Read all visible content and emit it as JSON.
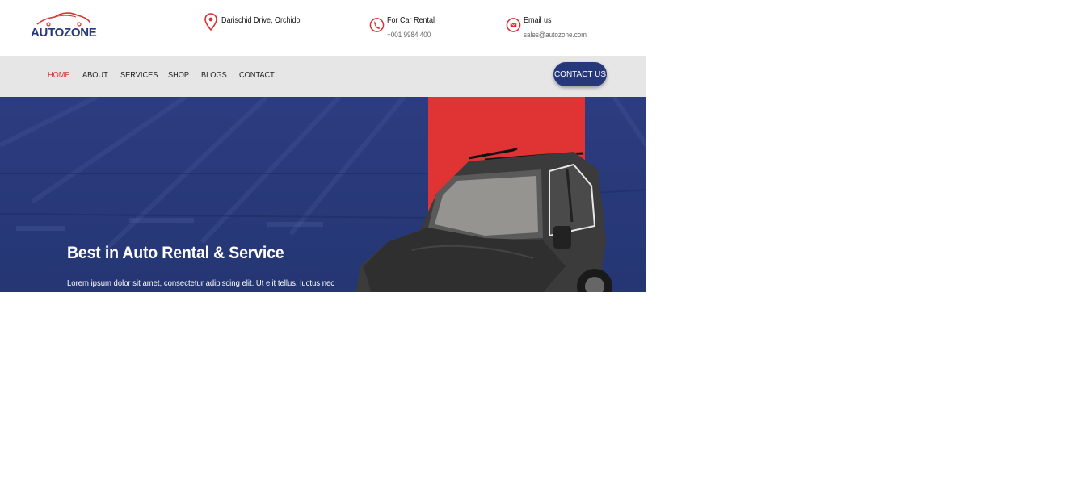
{
  "brand": {
    "name": "AUTOZONE"
  },
  "contact_info": {
    "address": {
      "icon": "map-pin-icon",
      "text": "Darischid Drive, Orchido"
    },
    "phone": {
      "icon": "phone-icon",
      "label": "For Car Rental",
      "value": "+001 9984 400"
    },
    "email": {
      "icon": "mail-icon",
      "label": "Email us",
      "value": "sales@autozone.com"
    }
  },
  "nav": {
    "items": [
      {
        "label": "HOME",
        "active": true
      },
      {
        "label": "ABOUT",
        "active": false
      },
      {
        "label": "SERVICES",
        "active": false
      },
      {
        "label": "SHOP",
        "active": false
      },
      {
        "label": "BLOGS",
        "active": false
      },
      {
        "label": "CONTACT",
        "active": false
      }
    ],
    "cta_label": "CONTACT US"
  },
  "hero": {
    "title": "Best in Auto Rental & Service",
    "subtitle": "Lorem ipsum dolor sit amet, consectetur adipiscing elit. Ut elit tellus, luctus nec"
  },
  "colors": {
    "brand_blue": "#26377a",
    "accent_red": "#d7322f",
    "nav_bg": "#e6e6e6"
  }
}
